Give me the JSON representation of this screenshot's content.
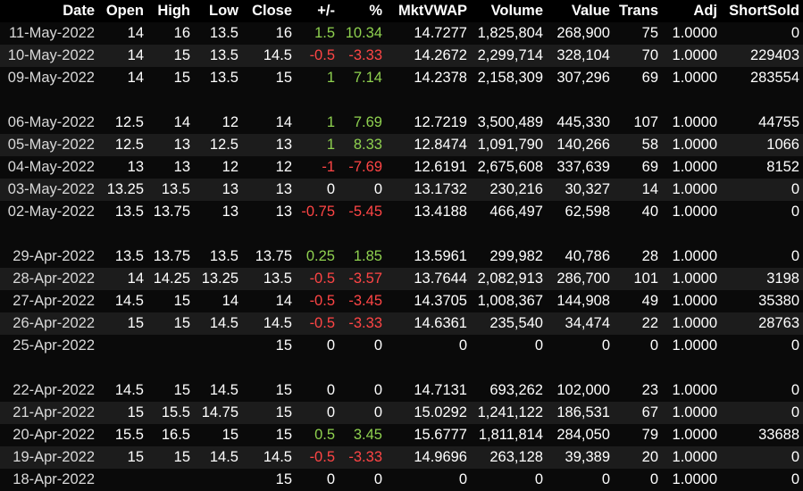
{
  "colors": {
    "positive": "#8fd14f",
    "negative": "#ff4545",
    "background": "#000000"
  },
  "columns": [
    "Date",
    "Open",
    "High",
    "Low",
    "Close",
    "+/-",
    "%",
    "MktVWAP",
    "Volume",
    "Value",
    "Trans",
    "Adj",
    "ShortSold"
  ],
  "rows": [
    {
      "date": "11-May-2022",
      "open": "14",
      "high": "16",
      "low": "13.5",
      "close": "16",
      "chg": "1.5",
      "pct": "10.34",
      "vwap": "14.7277",
      "volume": "1,825,804",
      "value": "268,900",
      "trans": "75",
      "adj": "1.0000",
      "short": "0",
      "dir": "pos"
    },
    {
      "date": "10-May-2022",
      "open": "14",
      "high": "15",
      "low": "13.5",
      "close": "14.5",
      "chg": "-0.5",
      "pct": "-3.33",
      "vwap": "14.2672",
      "volume": "2,299,714",
      "value": "328,104",
      "trans": "70",
      "adj": "1.0000",
      "short": "229403",
      "dir": "neg"
    },
    {
      "date": "09-May-2022",
      "open": "14",
      "high": "15",
      "low": "13.5",
      "close": "15",
      "chg": "1",
      "pct": "7.14",
      "vwap": "14.2378",
      "volume": "2,158,309",
      "value": "307,296",
      "trans": "69",
      "adj": "1.0000",
      "short": "283554",
      "dir": "pos"
    },
    {
      "spacer": true
    },
    {
      "date": "06-May-2022",
      "open": "12.5",
      "high": "14",
      "low": "12",
      "close": "14",
      "chg": "1",
      "pct": "7.69",
      "vwap": "12.7219",
      "volume": "3,500,489",
      "value": "445,330",
      "trans": "107",
      "adj": "1.0000",
      "short": "44755",
      "dir": "pos"
    },
    {
      "date": "05-May-2022",
      "open": "12.5",
      "high": "13",
      "low": "12.5",
      "close": "13",
      "chg": "1",
      "pct": "8.33",
      "vwap": "12.8474",
      "volume": "1,091,790",
      "value": "140,266",
      "trans": "58",
      "adj": "1.0000",
      "short": "1066",
      "dir": "pos"
    },
    {
      "date": "04-May-2022",
      "open": "13",
      "high": "13",
      "low": "12",
      "close": "12",
      "chg": "-1",
      "pct": "-7.69",
      "vwap": "12.6191",
      "volume": "2,675,608",
      "value": "337,639",
      "trans": "69",
      "adj": "1.0000",
      "short": "8152",
      "dir": "neg"
    },
    {
      "date": "03-May-2022",
      "open": "13.25",
      "high": "13.5",
      "low": "13",
      "close": "13",
      "chg": "0",
      "pct": "0",
      "vwap": "13.1732",
      "volume": "230,216",
      "value": "30,327",
      "trans": "14",
      "adj": "1.0000",
      "short": "0",
      "dir": "zero"
    },
    {
      "date": "02-May-2022",
      "open": "13.5",
      "high": "13.75",
      "low": "13",
      "close": "13",
      "chg": "-0.75",
      "pct": "-5.45",
      "vwap": "13.4188",
      "volume": "466,497",
      "value": "62,598",
      "trans": "40",
      "adj": "1.0000",
      "short": "0",
      "dir": "neg"
    },
    {
      "spacer": true
    },
    {
      "date": "29-Apr-2022",
      "open": "13.5",
      "high": "13.75",
      "low": "13.5",
      "close": "13.75",
      "chg": "0.25",
      "pct": "1.85",
      "vwap": "13.5961",
      "volume": "299,982",
      "value": "40,786",
      "trans": "28",
      "adj": "1.0000",
      "short": "0",
      "dir": "pos"
    },
    {
      "date": "28-Apr-2022",
      "open": "14",
      "high": "14.25",
      "low": "13.25",
      "close": "13.5",
      "chg": "-0.5",
      "pct": "-3.57",
      "vwap": "13.7644",
      "volume": "2,082,913",
      "value": "286,700",
      "trans": "101",
      "adj": "1.0000",
      "short": "3198",
      "dir": "neg"
    },
    {
      "date": "27-Apr-2022",
      "open": "14.5",
      "high": "15",
      "low": "14",
      "close": "14",
      "chg": "-0.5",
      "pct": "-3.45",
      "vwap": "14.3705",
      "volume": "1,008,367",
      "value": "144,908",
      "trans": "49",
      "adj": "1.0000",
      "short": "35380",
      "dir": "neg"
    },
    {
      "date": "26-Apr-2022",
      "open": "15",
      "high": "15",
      "low": "14.5",
      "close": "14.5",
      "chg": "-0.5",
      "pct": "-3.33",
      "vwap": "14.6361",
      "volume": "235,540",
      "value": "34,474",
      "trans": "22",
      "adj": "1.0000",
      "short": "28763",
      "dir": "neg"
    },
    {
      "date": "25-Apr-2022",
      "open": "",
      "high": "",
      "low": "",
      "close": "15",
      "chg": "0",
      "pct": "0",
      "vwap": "0",
      "volume": "0",
      "value": "0",
      "trans": "0",
      "adj": "1.0000",
      "short": "0",
      "dir": "zero"
    },
    {
      "spacer": true
    },
    {
      "date": "22-Apr-2022",
      "open": "14.5",
      "high": "15",
      "low": "14.5",
      "close": "15",
      "chg": "0",
      "pct": "0",
      "vwap": "14.7131",
      "volume": "693,262",
      "value": "102,000",
      "trans": "23",
      "adj": "1.0000",
      "short": "0",
      "dir": "zero"
    },
    {
      "date": "21-Apr-2022",
      "open": "15",
      "high": "15.5",
      "low": "14.75",
      "close": "15",
      "chg": "0",
      "pct": "0",
      "vwap": "15.0292",
      "volume": "1,241,122",
      "value": "186,531",
      "trans": "67",
      "adj": "1.0000",
      "short": "0",
      "dir": "zero"
    },
    {
      "date": "20-Apr-2022",
      "open": "15.5",
      "high": "16.5",
      "low": "15",
      "close": "15",
      "chg": "0.5",
      "pct": "3.45",
      "vwap": "15.6777",
      "volume": "1,811,814",
      "value": "284,050",
      "trans": "79",
      "adj": "1.0000",
      "short": "33688",
      "dir": "pos"
    },
    {
      "date": "19-Apr-2022",
      "open": "15",
      "high": "15",
      "low": "14.5",
      "close": "14.5",
      "chg": "-0.5",
      "pct": "-3.33",
      "vwap": "14.9696",
      "volume": "263,128",
      "value": "39,389",
      "trans": "20",
      "adj": "1.0000",
      "short": "0",
      "dir": "neg"
    },
    {
      "date": "18-Apr-2022",
      "open": "",
      "high": "",
      "low": "",
      "close": "15",
      "chg": "0",
      "pct": "0",
      "vwap": "0",
      "volume": "0",
      "value": "0",
      "trans": "0",
      "adj": "1.0000",
      "short": "0",
      "dir": "zero"
    }
  ]
}
